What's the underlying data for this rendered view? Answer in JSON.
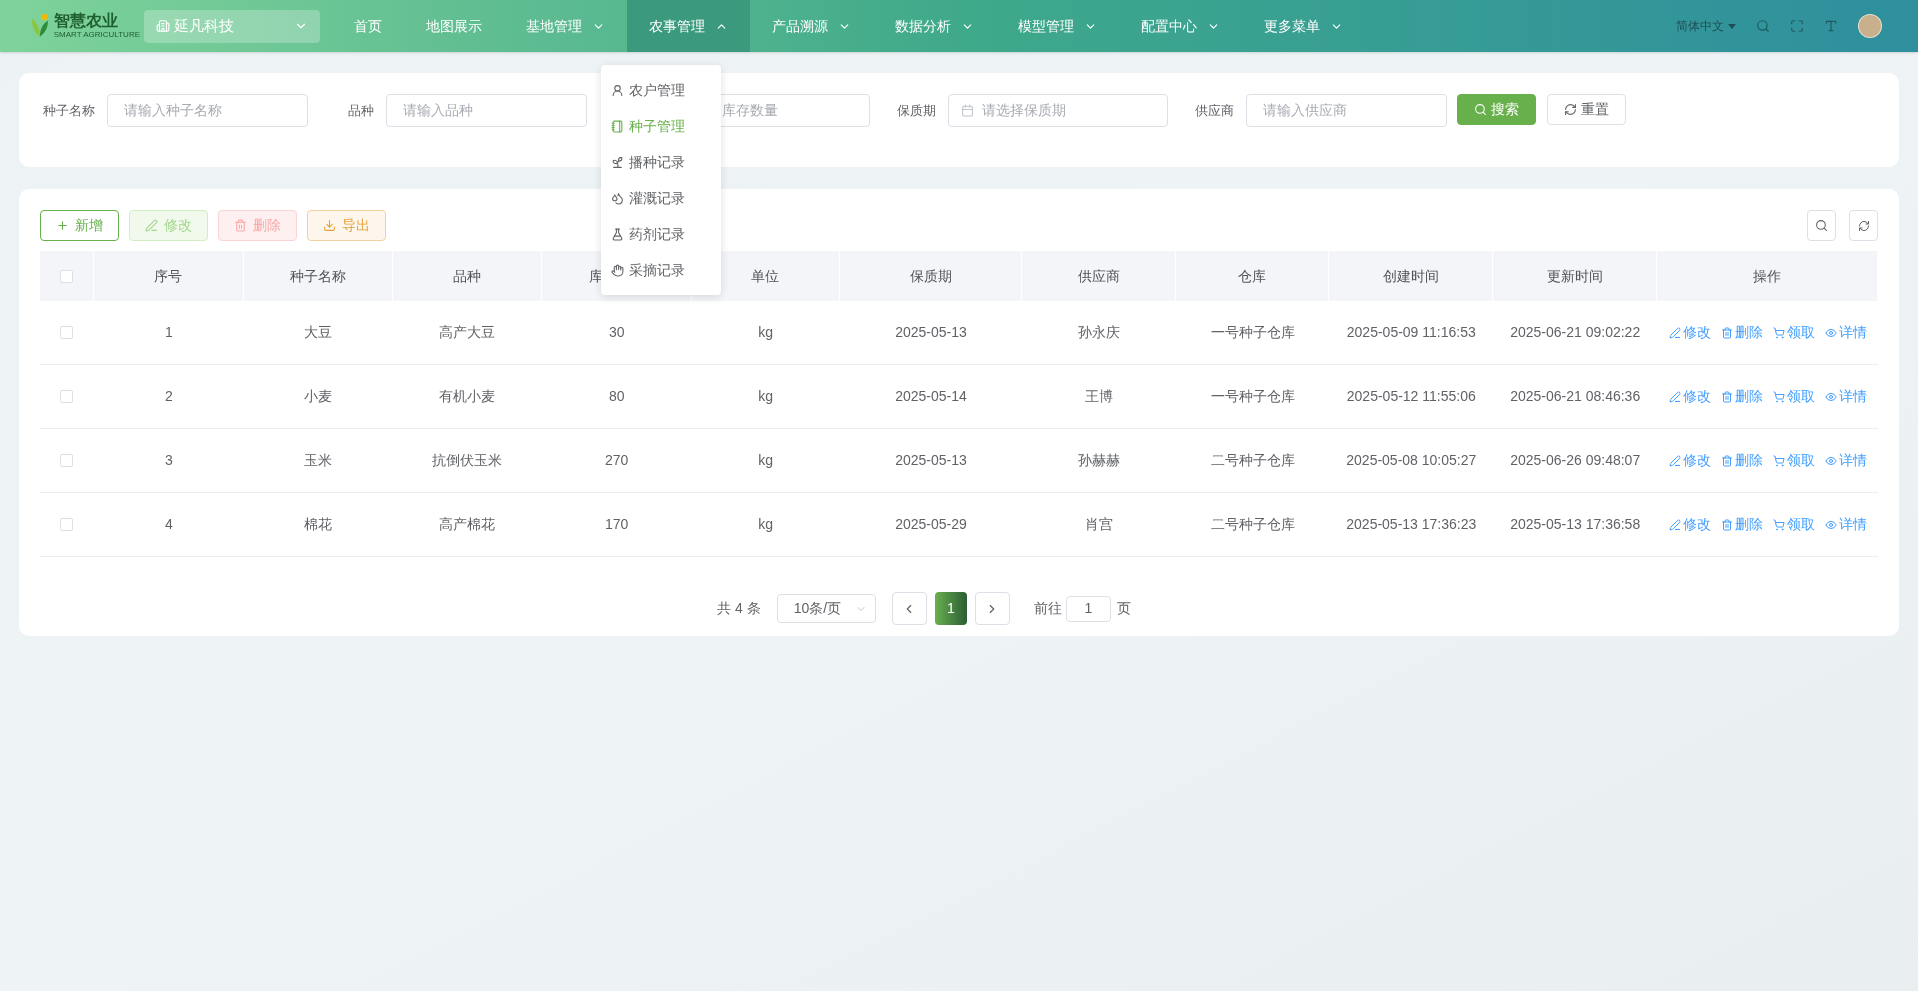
{
  "header": {
    "logo": {
      "title": "智慧农业",
      "subtitle": "SMART AGRICULTURE"
    },
    "org_select": "延凡科技",
    "nav": [
      {
        "label": "首页",
        "has_menu": false,
        "selected": false
      },
      {
        "label": "地图展示",
        "has_menu": false,
        "selected": false
      },
      {
        "label": "基地管理",
        "has_menu": true,
        "selected": false
      },
      {
        "label": "农事管理",
        "has_menu": true,
        "selected": true
      },
      {
        "label": "产品溯源",
        "has_menu": true,
        "selected": false
      },
      {
        "label": "数据分析",
        "has_menu": true,
        "selected": false
      },
      {
        "label": "模型管理",
        "has_menu": true,
        "selected": false
      },
      {
        "label": "配置中心",
        "has_menu": true,
        "selected": false
      },
      {
        "label": "更多菜单",
        "has_menu": true,
        "selected": false
      }
    ],
    "language": "简体中文"
  },
  "submenu": [
    {
      "label": "农户管理",
      "selected": false
    },
    {
      "label": "种子管理",
      "selected": true
    },
    {
      "label": "播种记录",
      "selected": false
    },
    {
      "label": "灌溉记录",
      "selected": false
    },
    {
      "label": "药剂记录",
      "selected": false
    },
    {
      "label": "采摘记录",
      "selected": false
    }
  ],
  "filters": [
    {
      "label": "种子名称",
      "placeholder": "请输入种子名称",
      "kind": "text"
    },
    {
      "label": "品种",
      "placeholder": "请输入品种",
      "kind": "text"
    },
    {
      "placeholder": "库存数量",
      "kind": "covered"
    },
    {
      "label": "保质期",
      "placeholder": "请选择保质期",
      "kind": "date"
    },
    {
      "label": "供应商",
      "placeholder": "请输入供应商",
      "kind": "text"
    }
  ],
  "filter_buttons": [
    {
      "label": "搜索",
      "kind": "primary"
    },
    {
      "label": "重置",
      "kind": "reset"
    }
  ],
  "toolbar": [
    {
      "label": "新增",
      "kind": "add",
      "disabled": false
    },
    {
      "label": "修改",
      "kind": "edit",
      "disabled": true
    },
    {
      "label": "删除",
      "kind": "delete",
      "disabled": true
    },
    {
      "label": "导出",
      "kind": "export",
      "disabled": false
    }
  ],
  "table": {
    "select_all_checked": false,
    "columns": [
      "序号",
      "种子名称",
      "品种",
      "库",
      "单位",
      "保质期",
      "供应商",
      "仓库",
      "创建时间",
      "更新时间",
      "操作"
    ],
    "rows": [
      {
        "checked": false,
        "cells": [
          "1",
          "大豆",
          "高产大豆",
          "30",
          "kg",
          "2025-05-13",
          "孙永庆",
          "一号种子仓库",
          "2025-05-09 11:16:53",
          "2025-06-21 09:02:22"
        ],
        "actions": [
          "修改",
          "删除",
          "领取",
          "详情"
        ]
      },
      {
        "checked": false,
        "cells": [
          "2",
          "小麦",
          "有机小麦",
          "80",
          "kg",
          "2025-05-14",
          "王博",
          "一号种子仓库",
          "2025-05-12 11:55:06",
          "2025-06-21 08:46:36"
        ],
        "actions": [
          "修改",
          "删除",
          "领取",
          "详情"
        ]
      },
      {
        "checked": false,
        "cells": [
          "3",
          "玉米",
          "抗倒伏玉米",
          "270",
          "kg",
          "2025-05-13",
          "孙赫赫",
          "二号种子仓库",
          "2025-05-08 10:05:27",
          "2025-06-26 09:48:07"
        ],
        "actions": [
          "修改",
          "删除",
          "领取",
          "详情"
        ]
      },
      {
        "checked": false,
        "cells": [
          "4",
          "棉花",
          "高产棉花",
          "170",
          "kg",
          "2025-05-29",
          "肖宫",
          "二号种子仓库",
          "2025-05-13 17:36:23",
          "2025-05-13 17:36:58"
        ],
        "actions": [
          "修改",
          "删除",
          "领取",
          "详情"
        ]
      }
    ]
  },
  "pagination": {
    "total": "共 4 条",
    "page_size": "10条/页",
    "pages": [
      {
        "label": "1",
        "selected": true
      }
    ],
    "goto_label": "前往",
    "goto_value": "1",
    "goto_suffix": "页"
  }
}
